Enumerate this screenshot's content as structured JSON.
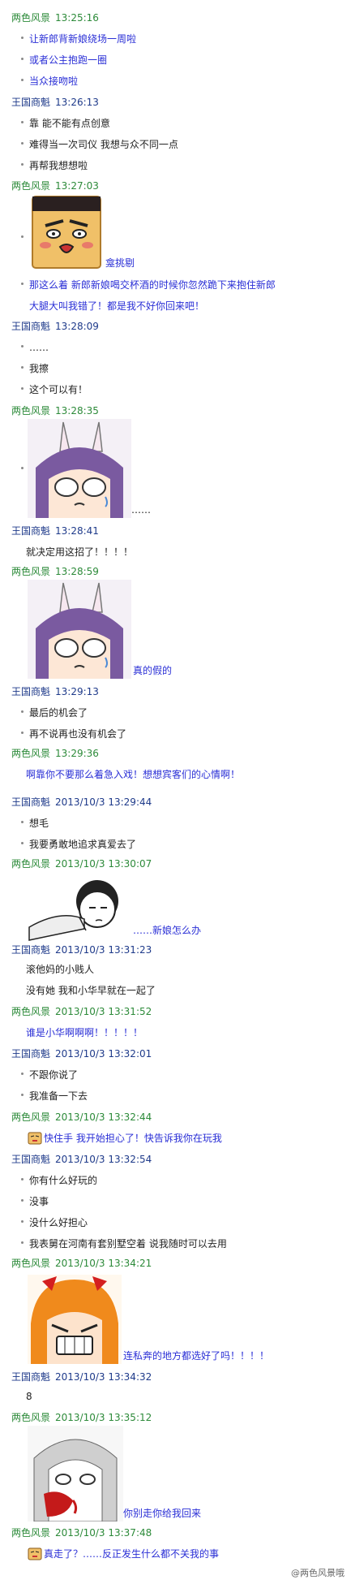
{
  "colors": {
    "green_sender": "#2c8a39",
    "blue_sender": "#1e3a8a",
    "blue_text": "#2a2fd6",
    "dark_text": "#222222"
  },
  "messages": [
    {
      "sender": "两色风景",
      "time": "13:25:16",
      "color": "green",
      "lines": [
        {
          "text": "让新郎背新娘绕场一周啦",
          "style": "blue"
        },
        {
          "text": "或者公主抱跑一圈",
          "style": "blue"
        },
        {
          "text": "当众接吻啦",
          "style": "blue"
        }
      ]
    },
    {
      "sender": "王国商魁",
      "time": "13:26:13",
      "color": "blue",
      "lines": [
        {
          "text": "靠 能不能有点创意",
          "style": "dark"
        },
        {
          "text": "难得当一次司仪 我想与众不同一点",
          "style": "dark"
        },
        {
          "text": "再帮我想想啦",
          "style": "dark"
        }
      ]
    },
    {
      "sender": "两色风景",
      "time": "13:27:03",
      "color": "green",
      "lines": [
        {
          "text": "龛挑剔",
          "style": "blue"
        },
        {
          "text": "那这么着 新郎新娘喝交杯酒的时候你忽然跪下来抱住新郎",
          "style": "blue"
        },
        {
          "text": "大腿大叫我错了！都是我不好你回来吧！",
          "style": "blue"
        }
      ]
    },
    {
      "sender": "王国商魁",
      "time": "13:28:09",
      "color": "blue",
      "lines": [
        {
          "text": "……",
          "style": "dark"
        },
        {
          "text": "我擦",
          "style": "dark"
        },
        {
          "text": "这个可以有！",
          "style": "dark"
        }
      ]
    },
    {
      "sender": "两色风景",
      "time": "13:28:35",
      "color": "green",
      "lines": [
        {
          "text": "……",
          "style": "dark"
        }
      ]
    },
    {
      "sender": "王国商魁",
      "time": "13:28:41",
      "color": "blue",
      "lines": [
        {
          "text": "就决定用这招了！！！！",
          "style": "dark"
        }
      ]
    },
    {
      "sender": "两色风景",
      "time": "13:28:59",
      "color": "green",
      "lines": [
        {
          "text": "真的假的",
          "style": "blue"
        }
      ]
    },
    {
      "sender": "王国商魁",
      "time": "13:29:13",
      "color": "blue",
      "lines": [
        {
          "text": "最后的机会了",
          "style": "dark"
        },
        {
          "text": "再不说再也没有机会了",
          "style": "dark"
        }
      ]
    },
    {
      "sender": "两色风景",
      "time": "13:29:36",
      "color": "green",
      "lines": [
        {
          "text": "啊靠你不要那么着急入戏！想想宾客们的心情啊！",
          "style": "blue"
        }
      ]
    },
    {
      "sender": "王国商魁",
      "time": "2013/10/3 13:29:44",
      "color": "blue",
      "lines": [
        {
          "text": "想毛",
          "style": "dark"
        },
        {
          "text": "我要勇敢地追求真爱去了",
          "style": "dark"
        }
      ]
    },
    {
      "sender": "两色风景",
      "time": "2013/10/3 13:30:07",
      "color": "green",
      "lines": [
        {
          "text": "……新娘怎么办",
          "style": "blue"
        }
      ]
    },
    {
      "sender": "王国商魁",
      "time": "2013/10/3 13:31:23",
      "color": "blue",
      "lines": [
        {
          "text": "滚他妈的小贱人",
          "style": "dark"
        },
        {
          "text": "没有她 我和小华早就在一起了",
          "style": "dark"
        }
      ]
    },
    {
      "sender": "两色风景",
      "time": "2013/10/3 13:31:52",
      "color": "green",
      "lines": [
        {
          "text": "谁是小华啊啊啊！！！！！",
          "style": "blue"
        }
      ]
    },
    {
      "sender": "王国商魁",
      "time": "2013/10/3 13:32:01",
      "color": "blue",
      "lines": [
        {
          "text": "不跟你说了",
          "style": "dark"
        },
        {
          "text": "我准备一下去",
          "style": "dark"
        }
      ]
    },
    {
      "sender": "两色风景",
      "time": "2013/10/3 13:32:44",
      "color": "green",
      "lines": [
        {
          "text": "快住手 我开始担心了！快告诉我你在玩我",
          "style": "blue"
        }
      ]
    },
    {
      "sender": "王国商魁",
      "time": "2013/10/3 13:32:54",
      "color": "blue",
      "lines": [
        {
          "text": "你有什么好玩的",
          "style": "dark"
        },
        {
          "text": "没事",
          "style": "dark"
        },
        {
          "text": "没什么好担心",
          "style": "dark"
        },
        {
          "text": "我表舅在河南有套别墅空着 说我随时可以去用",
          "style": "dark"
        }
      ]
    },
    {
      "sender": "两色风景",
      "time": "2013/10/3 13:34:21",
      "color": "green",
      "lines": [
        {
          "text": "连私奔的地方都选好了吗！！！！",
          "style": "blue"
        }
      ]
    },
    {
      "sender": "王国商魁",
      "time": "2013/10/3 13:34:32",
      "color": "blue",
      "lines": [
        {
          "text": "8",
          "style": "dark"
        }
      ]
    },
    {
      "sender": "两色风景",
      "time": "2013/10/3 13:35:12",
      "color": "green",
      "lines": [
        {
          "text": "你别走你给我回来",
          "style": "blue"
        }
      ]
    },
    {
      "sender": "两色风景",
      "time": "2013/10/3 13:37:48",
      "color": "green",
      "lines": [
        {
          "text": "真走了？……反正发生什么都不关我的事",
          "style": "blue"
        }
      ]
    }
  ],
  "watermark": "@两色风景哦"
}
